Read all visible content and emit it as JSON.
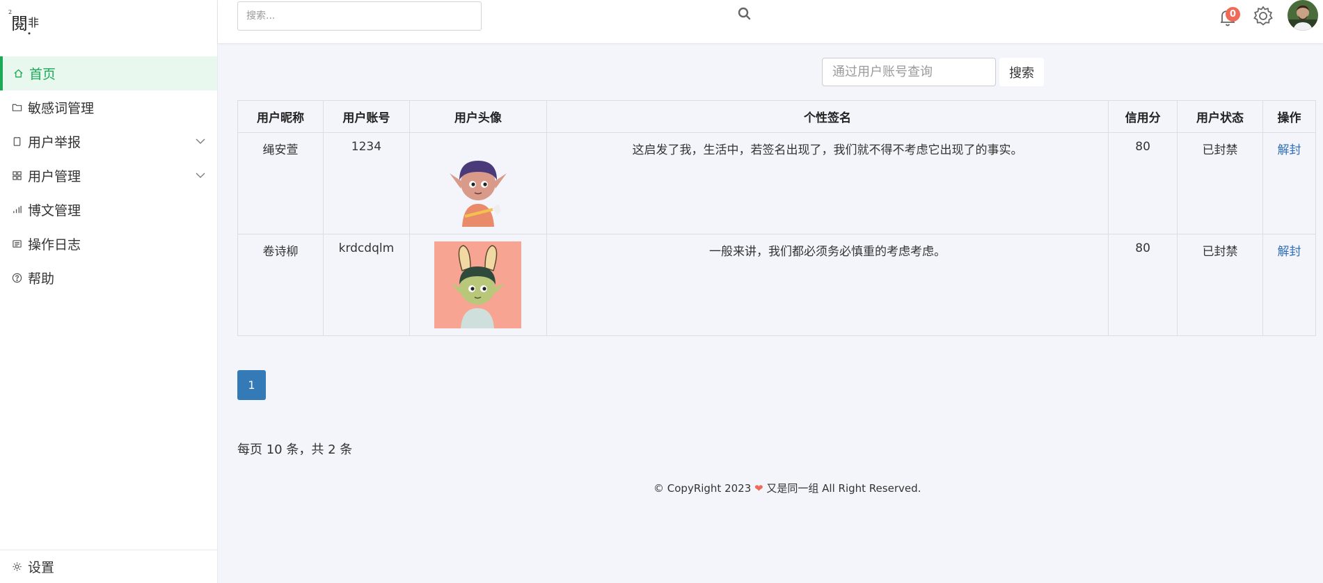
{
  "header": {
    "search_placeholder": "搜索...",
    "notification_count": "0"
  },
  "sidebar": {
    "items": [
      {
        "label": "首页",
        "icon": "home-icon"
      },
      {
        "label": "敏感词管理",
        "icon": "folder-icon"
      },
      {
        "label": "用户举报",
        "icon": "document-icon"
      },
      {
        "label": "用户管理",
        "icon": "grid-icon"
      },
      {
        "label": "博文管理",
        "icon": "bar-chart-icon"
      },
      {
        "label": "操作日志",
        "icon": "list-icon"
      },
      {
        "label": "帮助",
        "icon": "help-icon"
      }
    ],
    "settings_label": "设置"
  },
  "query": {
    "placeholder": "通过用户账号查询",
    "button_label": "搜索"
  },
  "table": {
    "columns": [
      "用户昵称",
      "用户账号",
      "用户头像",
      "个性签名",
      "信用分",
      "用户状态",
      "操作"
    ],
    "rows": [
      {
        "nickname": "绳安萱",
        "account": "1234",
        "signature": "这启发了我，生活中，若签名出现了，我们就不得不考虑它出现了的事实。",
        "credit": "80",
        "status": "已封禁",
        "action": "解封"
      },
      {
        "nickname": "卷诗柳",
        "account": "krdcdqlm",
        "signature": "一般来讲，我们都必须务必慎重的考虑考虑。",
        "credit": "80",
        "status": "已封禁",
        "action": "解封"
      }
    ]
  },
  "pagination": {
    "current_page": "1",
    "info": "每页 10 条，共 2 条"
  },
  "footer": {
    "prefix": "© CopyRight 2023",
    "suffix": "又是同一组 All Right Reserved."
  },
  "colors": {
    "accent": "#1aaa55",
    "banned": "#e02020",
    "link": "#2f6fb8",
    "pagination": "#337ab7"
  }
}
